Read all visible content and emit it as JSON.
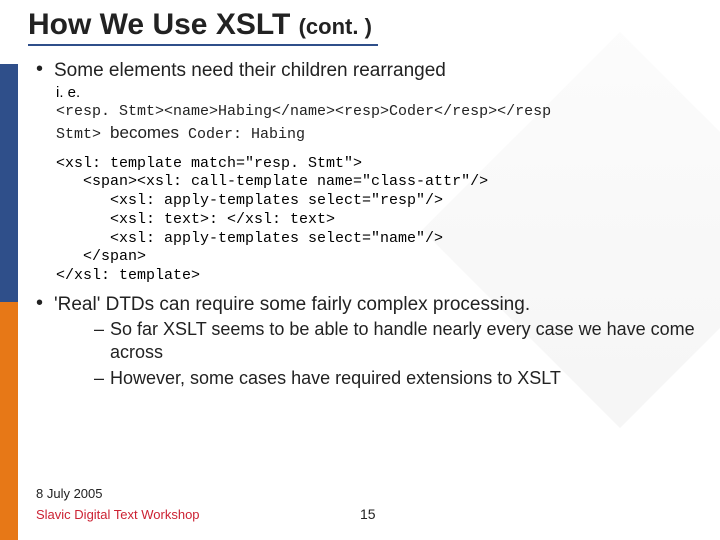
{
  "title": "How We Use XSLT",
  "title_sub": "(cont. )",
  "bullet1": "Some elements need their children rearranged",
  "ie_label": "i. e.",
  "code_example": "<resp. Stmt><name>Habing</name><resp>Coder</resp></resp\nStmt>",
  "becomes_label": "becomes",
  "becomes_result": "Coder: Habing",
  "xsl_lines": [
    "<xsl: template match=\"resp. Stmt\">",
    "   <span><xsl: call-template name=\"class-attr\"/>",
    "      <xsl: apply-templates select=\"resp\"/>",
    "      <xsl: text>: </xsl: text>",
    "      <xsl: apply-templates select=\"name\"/>",
    "   </span>",
    "</xsl: template>"
  ],
  "bullet2": "'Real' DTDs can require some fairly complex processing.",
  "sub1": "So far XSLT seems to be able to handle nearly every case we have come across",
  "sub2": "However, some cases have required extensions to XSLT",
  "footer_date": "8 July 2005",
  "footer_workshop": "Slavic Digital Text Workshop",
  "page_number": "15"
}
